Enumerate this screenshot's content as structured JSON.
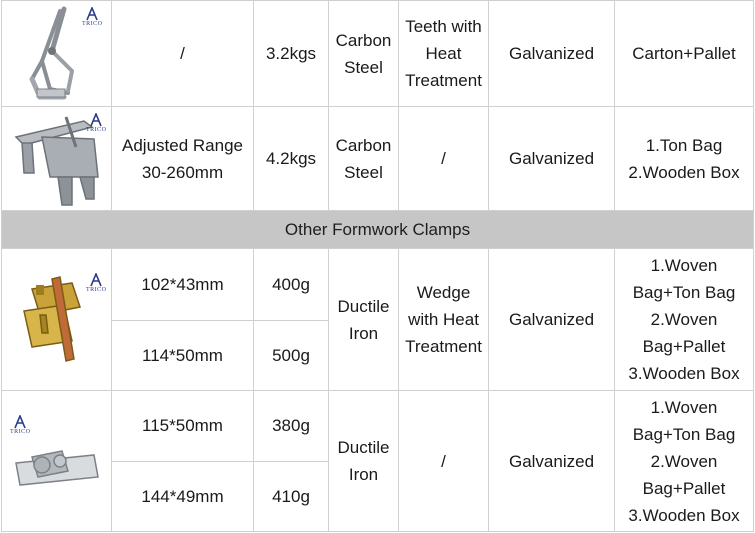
{
  "brand_logo_text": "TRICO",
  "section_title": "Other Formwork Clamps",
  "rows": [
    {
      "image_icon": "clamp-lever-icon",
      "spec": "/",
      "weight": "3.2kgs",
      "material": [
        "Carbon",
        "Steel"
      ],
      "feature": [
        "Teeth with",
        "Heat",
        "Treatment"
      ],
      "surface": "Galvanized",
      "packing": [
        "Carton+Pallet"
      ]
    },
    {
      "image_icon": "adjustable-clamp-icon",
      "spec": [
        "Adjusted Range",
        "30-260mm"
      ],
      "weight": "4.2kgs",
      "material": [
        "Carbon",
        "Steel"
      ],
      "feature": [
        "/"
      ],
      "surface": "Galvanized",
      "packing": [
        "1.Ton Bag",
        "2.Wooden Box"
      ]
    }
  ],
  "groups": [
    {
      "image_icon": "wedge-clamp-icon",
      "sub": [
        {
          "spec": "102*43mm",
          "weight": "400g"
        },
        {
          "spec": "114*50mm",
          "weight": "500g"
        }
      ],
      "material": [
        "Ductile",
        "Iron"
      ],
      "feature": [
        "Wedge",
        "with Heat",
        "Treatment"
      ],
      "surface": "Galvanized",
      "packing": [
        "1.Woven",
        "Bag+Ton Bag",
        "2.Woven",
        "Bag+Pallet",
        "3.Wooden Box"
      ]
    },
    {
      "image_icon": "spring-clamp-icon",
      "sub": [
        {
          "spec": "115*50mm",
          "weight": "380g"
        },
        {
          "spec": "144*49mm",
          "weight": "410g"
        }
      ],
      "material": [
        "Ductile",
        "Iron"
      ],
      "feature": [
        "/"
      ],
      "surface": "Galvanized",
      "packing": [
        "1.Woven",
        "Bag+Ton Bag",
        "2.Woven",
        "Bag+Pallet",
        "3.Wooden Box"
      ]
    }
  ]
}
